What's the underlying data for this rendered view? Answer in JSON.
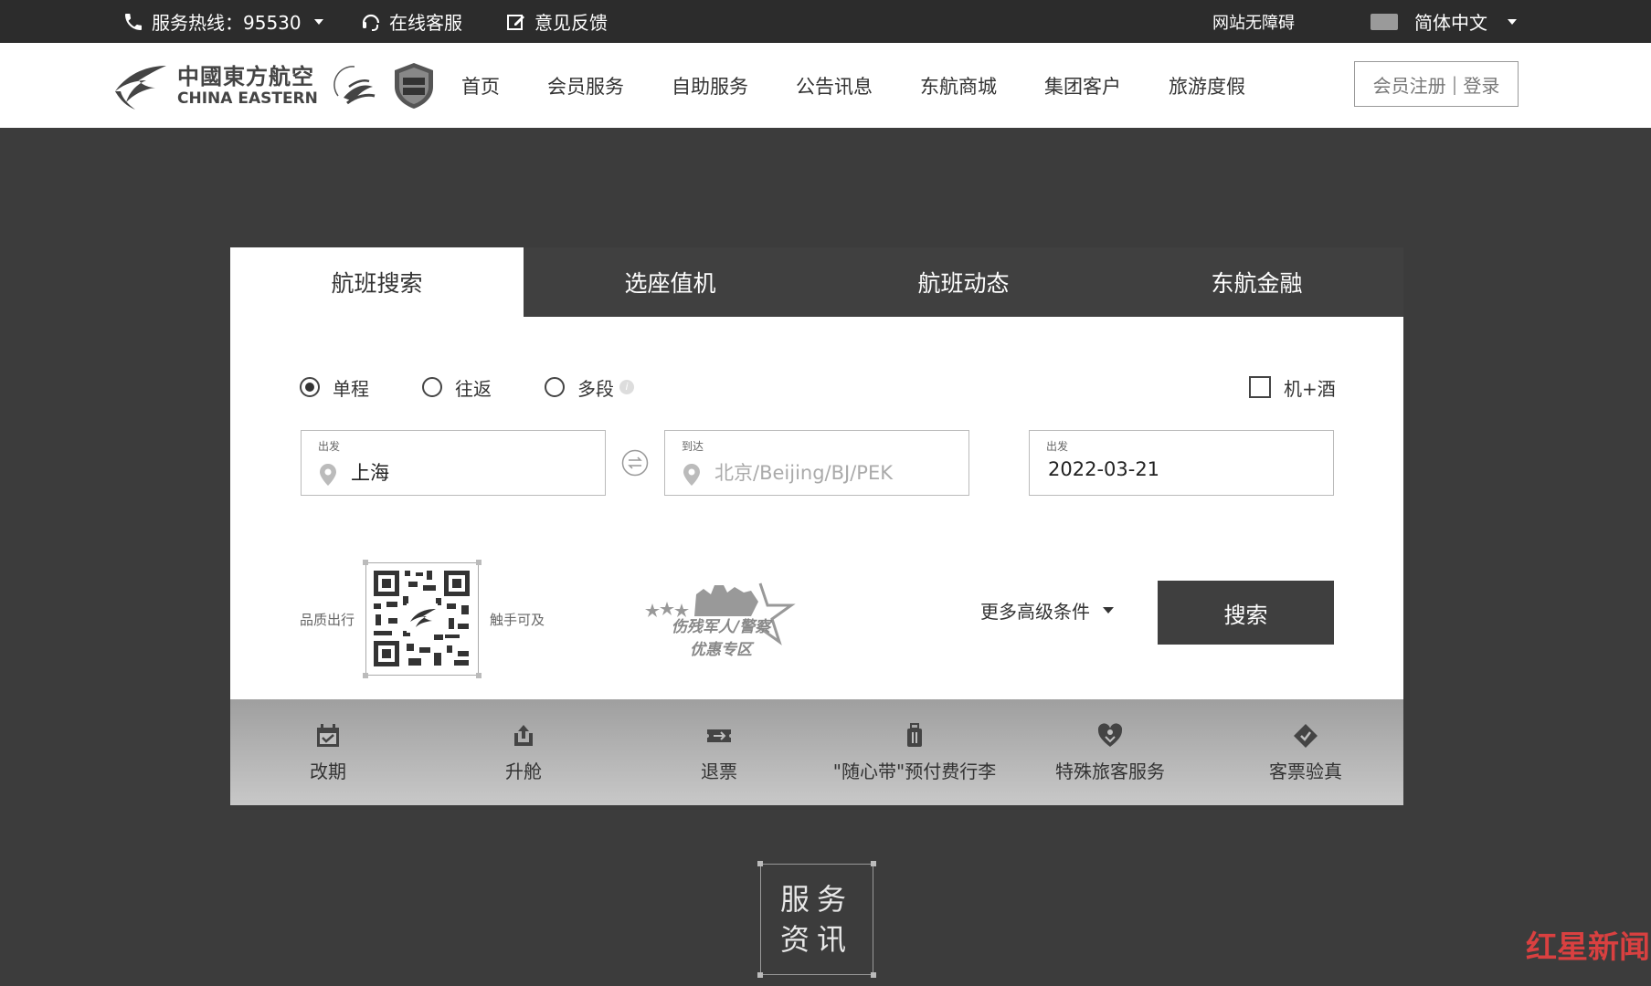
{
  "topbar": {
    "hotline": "服务热线：95530",
    "online_service": "在线客服",
    "feedback": "意见反馈",
    "accessibility": "网站无障碍",
    "language": "简体中文"
  },
  "header": {
    "logo_cn": "中國東方航空",
    "logo_en": "CHINA EASTERN",
    "nav": [
      "首页",
      "会员服务",
      "自助服务",
      "公告讯息",
      "东航商城",
      "集团客户",
      "旅游度假"
    ],
    "register": "会员注册",
    "login": "登录"
  },
  "tabs": [
    "航班搜索",
    "选座值机",
    "航班动态",
    "东航金融"
  ],
  "trip_types": {
    "one_way": "单程",
    "round_trip": "往返",
    "multi": "多段",
    "selected": "单程",
    "flight_hotel": "机+酒"
  },
  "search": {
    "depart_label": "出发",
    "depart_value": "上海",
    "arrive_label": "到达",
    "arrive_placeholder": "北京/Beijing/BJ/PEK",
    "date_label": "出发",
    "date_value": "2022-03-21",
    "qr_left": "品质出行",
    "qr_right": "触手可及",
    "promo_line1": "伤残军人/警察",
    "promo_line2": "优惠专区",
    "advanced": "更多高级条件",
    "search_button": "搜索"
  },
  "services": [
    {
      "label": "改期",
      "icon": "calendar-check-icon"
    },
    {
      "label": "升舱",
      "icon": "seat-upgrade-icon"
    },
    {
      "label": "退票",
      "icon": "refund-ticket-icon"
    },
    {
      "label": "\"随心带\"预付费行李",
      "icon": "luggage-icon"
    },
    {
      "label": "特殊旅客服务",
      "icon": "heart-hand-icon"
    },
    {
      "label": "客票验真",
      "icon": "ticket-verify-icon"
    }
  ],
  "news_box": {
    "line1": "服务",
    "line2": "资讯"
  },
  "watermark": "红星新闻"
}
